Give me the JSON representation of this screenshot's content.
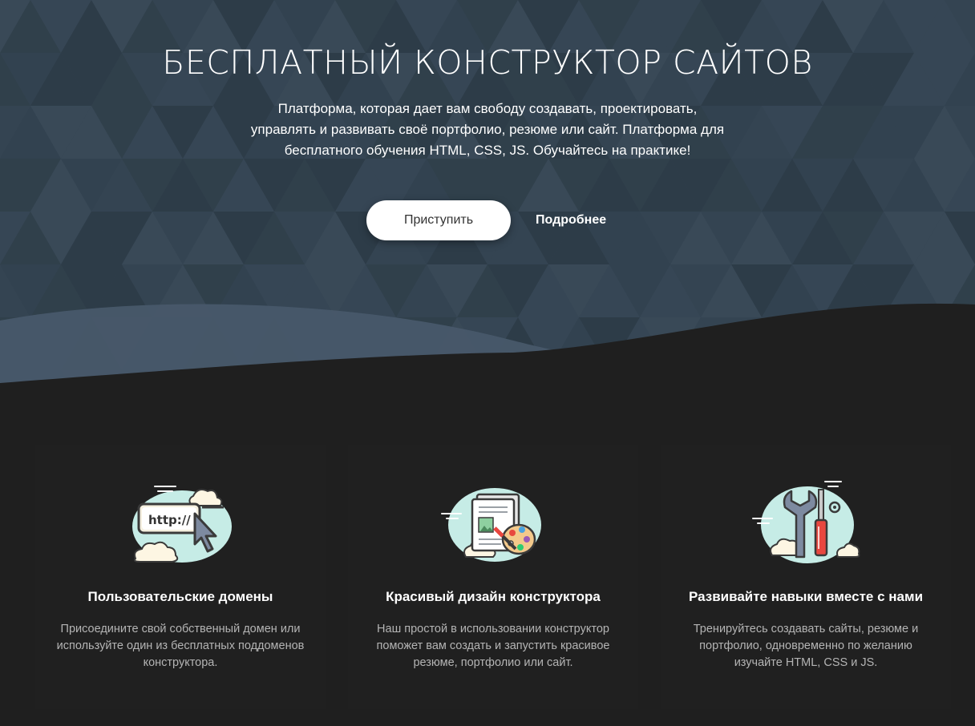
{
  "hero": {
    "title": "БЕСПЛАТНЫЙ КОНСТРУКТОР САЙТОВ",
    "subtitle": "Платформа, которая дает вам свободу создавать, проектировать, управлять и развивать своё портфолио, резюме или сайт. Платформа для бесплатного обучения HTML, CSS, JS. Обучайтесь на практике!",
    "start_label": "Приступить",
    "more_label": "Подробнее"
  },
  "features": [
    {
      "icon": "browser-url-cursor-icon",
      "url_text": "http://",
      "title": "Пользовательские домены",
      "text": "Присоедините свой собственный домен или используйте один из бесплатных поддоменов конструктора."
    },
    {
      "icon": "design-palette-icon",
      "title": "Красивый дизайн конструктора",
      "text": "Наш простой в использовании конструктор поможет вам создать и запустить красивое резюме, портфолио или сайт."
    },
    {
      "icon": "wrench-screwdriver-icon",
      "title": "Развивайте навыки вместе с нами",
      "text": "Тренируйтесь создавать сайты, резюме и портфолио, одновременно по желанию изучайте HTML, CSS и JS."
    }
  ],
  "colors": {
    "hero_bg": "#3a4a5a",
    "page_bg": "#1f1f1f",
    "cloud": "#c6ece6",
    "accent_red": "#e8473f"
  }
}
